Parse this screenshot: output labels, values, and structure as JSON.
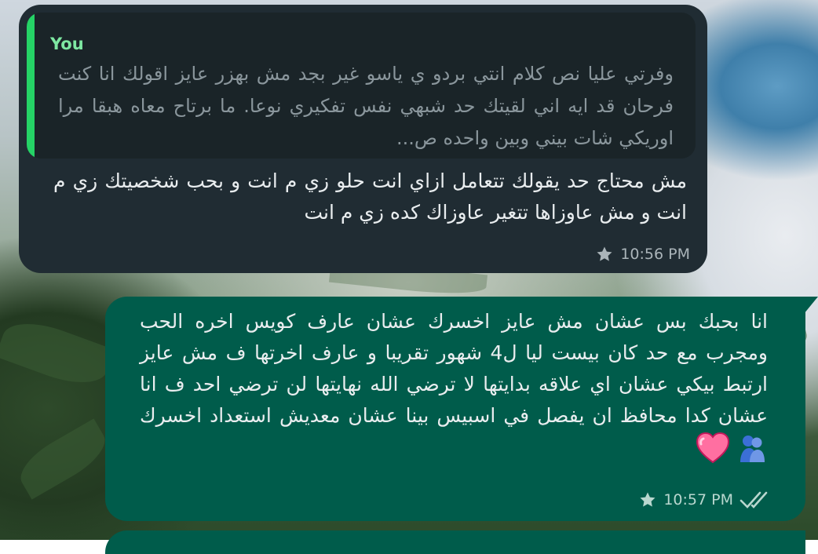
{
  "incoming": {
    "quote": {
      "author": "You",
      "text": "وفرتي عليا نص كلام انتي بردو ي ياسو غير بجد مش بهزر عايز اقولك انا كنت فرحان قد ايه اني لقيتك حد شبهي نفس تفكيري نوعا. ما برتاح معاه هبقا مرا اوريكي شات بيني وبين واحده ص..."
    },
    "text": "مش محتاج حد يقولك تتعامل ازاي انت حلو زي م انت و بحب شخصيتك زي م انت و مش عاوزاها تتغير عاوزاك كده زي م انت",
    "time": "10:56 PM",
    "starred": true
  },
  "outgoing": {
    "text": "انا بحبك بس عشان مش عايز اخسرك عشان عارف كويس اخره الحب ومجرب مع حد كان بيست ليا ل4 شهور تقريبا و عارف اخرتها ف مش عايز ارتبط بيكي عشان اي علاقه بدايتها لا ترضي الله نهايتها لن ترضي احد ف انا عشان كدا محافظ ان يفصل في اسبيس بينا عشان معديش استعداد اخسرك",
    "emojis": [
      "people-hugging-emoji",
      "pink-heart-emoji"
    ],
    "time": "10:57 PM",
    "starred": true,
    "status": "read"
  },
  "colors": {
    "incoming_bubble": "#202c33",
    "outgoing_bubble": "#005c4b",
    "quote_accent": "#25d366",
    "read_ticks": "#b9d7cf"
  }
}
